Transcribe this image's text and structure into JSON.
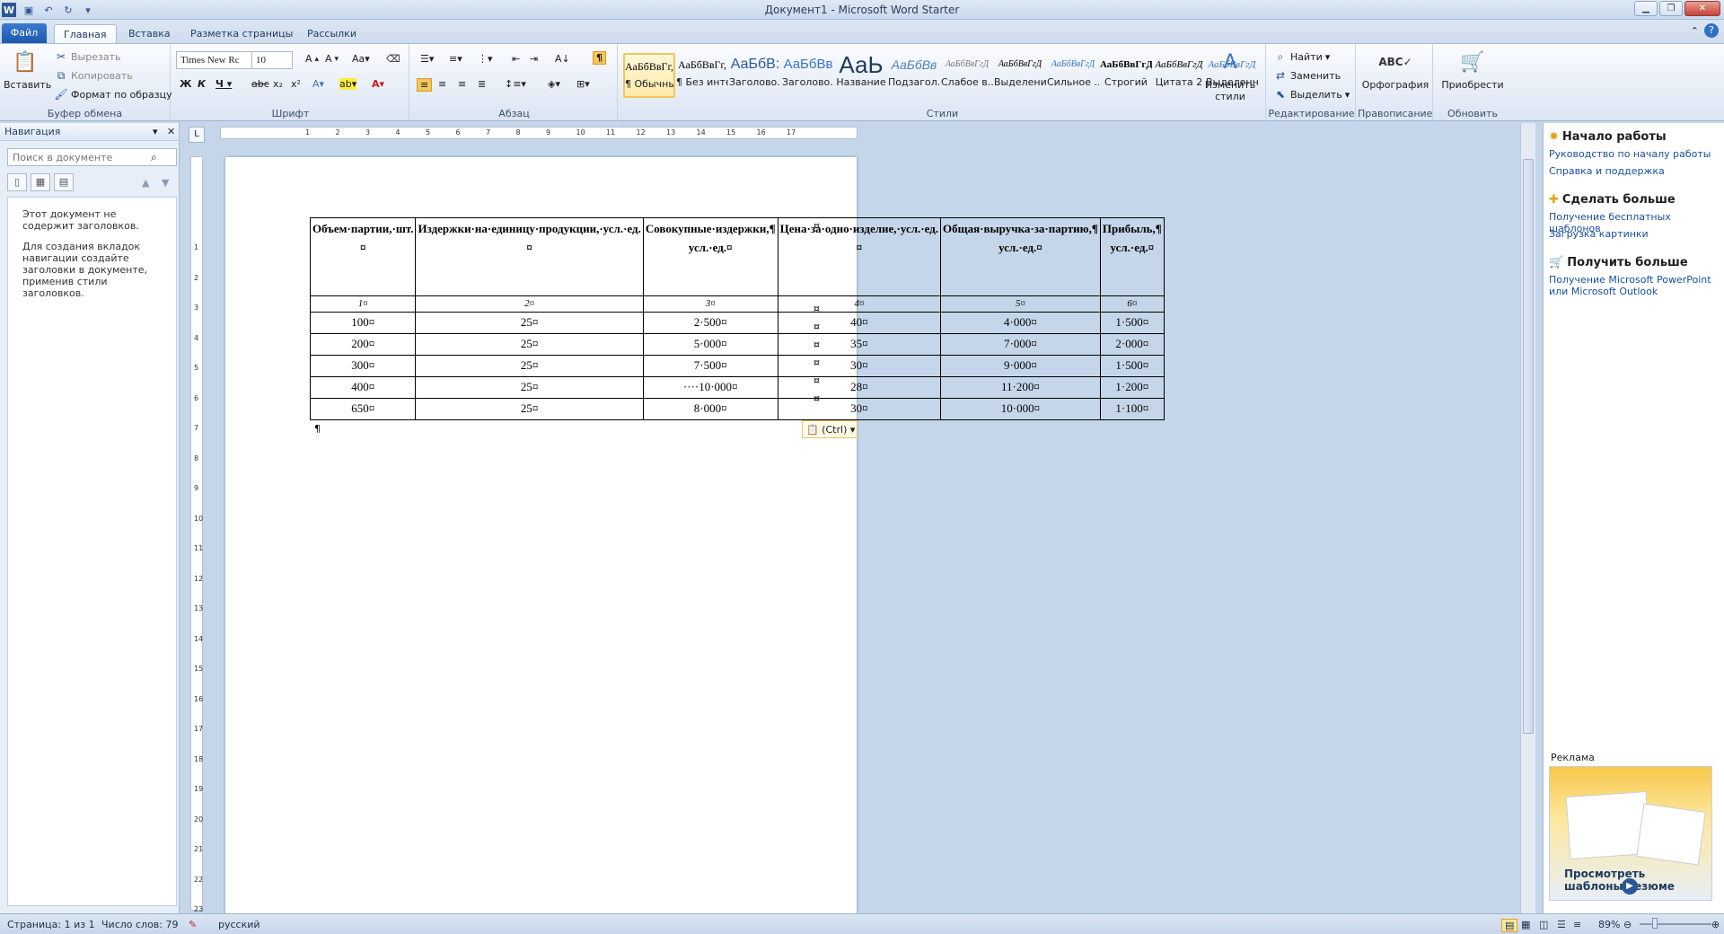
{
  "window": {
    "title": "Документ1 - Microsoft Word Starter"
  },
  "tabs": {
    "file": "Файл",
    "home": "Главная",
    "insert": "Вставка",
    "layout": "Разметка страницы",
    "mailings": "Рассылки"
  },
  "clipboard": {
    "paste": "Вставить",
    "cut": "Вырезать",
    "copy": "Копировать",
    "format": "Формат по образцу",
    "label": "Буфер обмена"
  },
  "font": {
    "name": "Times New Rc",
    "size": "10",
    "label": "Шрифт"
  },
  "paragraph": {
    "label": "Абзац"
  },
  "styles": {
    "label": "Стили",
    "change": "Изменить стили",
    "items": [
      {
        "sample": "АаБбВвГг,",
        "name": "¶ Обычный"
      },
      {
        "sample": "АаБбВвГг,",
        "name": "¶ Без инте..."
      },
      {
        "sample": "АаБбВ:",
        "name": "Заголово..."
      },
      {
        "sample": "АаБбВв",
        "name": "Заголово..."
      },
      {
        "sample": "АаЬ",
        "name": "Название"
      },
      {
        "sample": "АаБбВв",
        "name": "Подзагол..."
      },
      {
        "sample": "АаБбВвГгД",
        "name": "Слабое в..."
      },
      {
        "sample": "АаБбВвГгД",
        "name": "Выделение"
      },
      {
        "sample": "АаБбВвГгД",
        "name": "Сильное ..."
      },
      {
        "sample": "АаБбВвГгД",
        "name": "Строгий"
      },
      {
        "sample": "АаБбВвГгД",
        "name": "Цитата 2"
      },
      {
        "sample": "АаБбВвГгД",
        "name": "Выделенн..."
      }
    ]
  },
  "editing": {
    "find": "Найти",
    "replace": "Заменить",
    "select": "Выделить",
    "label": "Редактирование"
  },
  "proofing": {
    "spelling": "Орфография",
    "label": "Правописание"
  },
  "upgrade": {
    "buy": "Приобрести",
    "label": "Обновить"
  },
  "nav": {
    "title": "Навигация",
    "search_placeholder": "Поиск в документе",
    "msg1": "Этот документ не содержит заголовков.",
    "msg2": "Для создания вкладок навигации создайте заголовки в документе, применив стили заголовков."
  },
  "table": {
    "headers": [
      "Объем·партии,·шт.¤",
      "Издержки·на·единицу·продукции,·усл.·ед.¤",
      "Совокупные·издержки,¶ усл.·ед.¤",
      "Цена·за·одно·изделие,·усл.·ед.¤",
      "Общая·выручка·за·партию,¶ усл.·ед.¤",
      "Прибыль,¶ усл.·ед.¤"
    ],
    "numbers": [
      "1¤",
      "2¤",
      "3¤",
      "4¤",
      "5¤",
      "6¤"
    ],
    "rows": [
      [
        "100¤",
        "25¤",
        "2·500¤",
        "40¤",
        "4·000¤",
        "1·500¤"
      ],
      [
        "200¤",
        "25¤",
        "5·000¤",
        "35¤",
        "7·000¤",
        "2·000¤"
      ],
      [
        "300¤",
        "25¤",
        "7·500¤",
        "30¤",
        "9·000¤",
        "1·500¤"
      ],
      [
        "400¤",
        "25¤",
        "····10·000¤",
        "28¤",
        "11·200¤",
        "1·200¤"
      ],
      [
        "650¤",
        "25¤",
        "8·000¤",
        "30¤",
        "10·000¤",
        "1·100¤"
      ]
    ],
    "end_mark": "¤",
    "para_mark": "¶",
    "paste_badge": "(Ctrl)"
  },
  "rightpane": {
    "start": "Начало работы",
    "start_links": [
      "Руководство по началу работы",
      "Справка и поддержка"
    ],
    "more": "Сделать больше",
    "more_links": [
      "Получение бесплатных шаблонов",
      "Загрузка картинки"
    ],
    "get": "Получить больше",
    "get_links": [
      "Получение Microsoft PowerPoint или Microsoft Outlook"
    ],
    "ad_label": "Реклама",
    "ad_text": "Просмотреть шаблоны резюме"
  },
  "status": {
    "page": "Страница: 1 из 1",
    "words": "Число слов: 79",
    "lang": "русский",
    "zoom": "89%"
  }
}
